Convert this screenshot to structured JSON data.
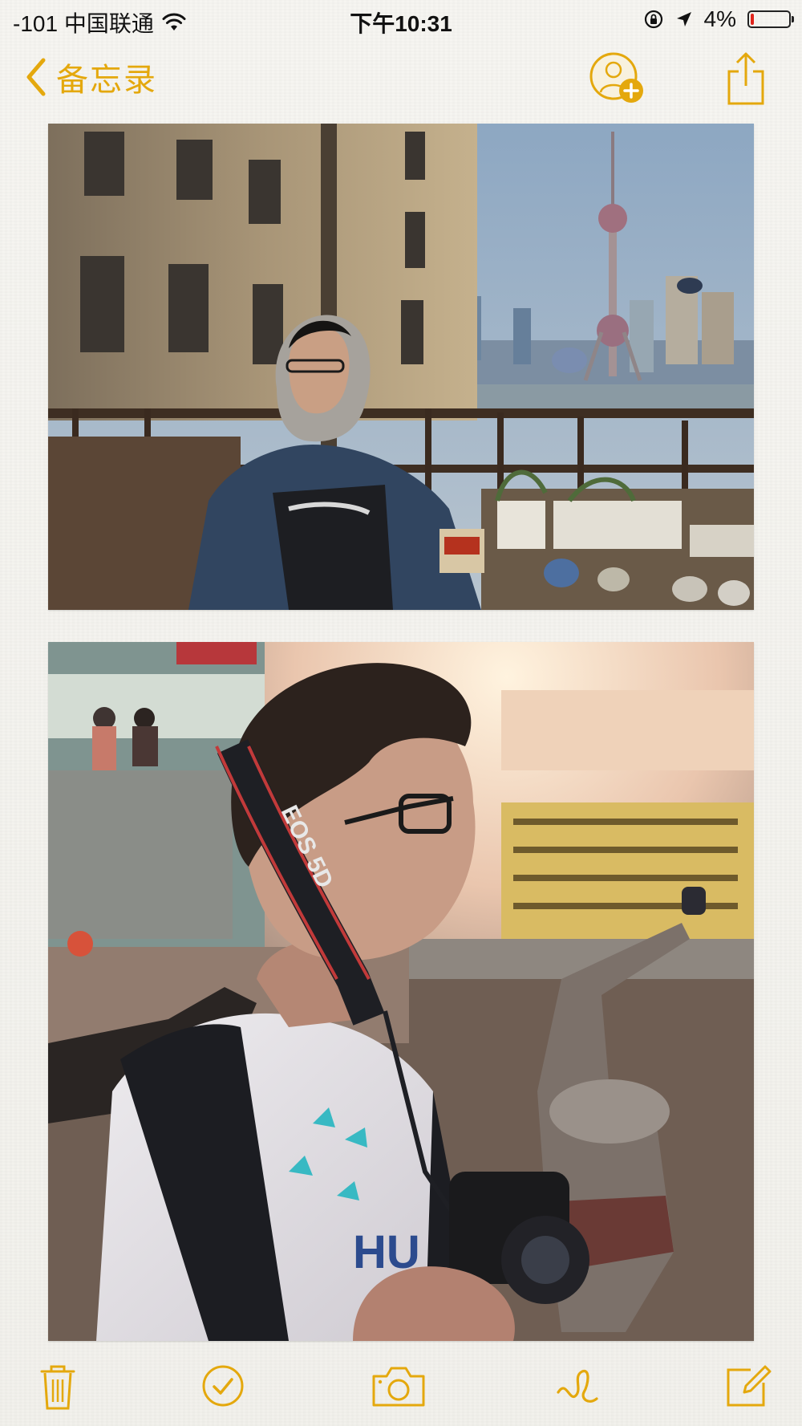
{
  "status_bar": {
    "carrier": "-101 中国联通",
    "time": "下午10:31",
    "battery_percent": "4%",
    "battery_level": 0.04,
    "icons": [
      "wifi-icon",
      "orientation-lock-icon",
      "location-arrow-icon",
      "battery-icon"
    ]
  },
  "nav": {
    "back_label": "备忘录",
    "icons": [
      "chevron-left-icon",
      "add-person-icon",
      "share-icon"
    ]
  },
  "note": {
    "photos": [
      {
        "name": "photo-bund-rooftop"
      },
      {
        "name": "photo-street-camera"
      }
    ]
  },
  "toolbar": {
    "icons": [
      "trash-icon",
      "checklist-icon",
      "camera-icon",
      "sketch-icon",
      "compose-icon"
    ]
  },
  "colors": {
    "accent": "#e4a80d",
    "battery_low": "#e0241b",
    "background": "#f4f3ef"
  }
}
